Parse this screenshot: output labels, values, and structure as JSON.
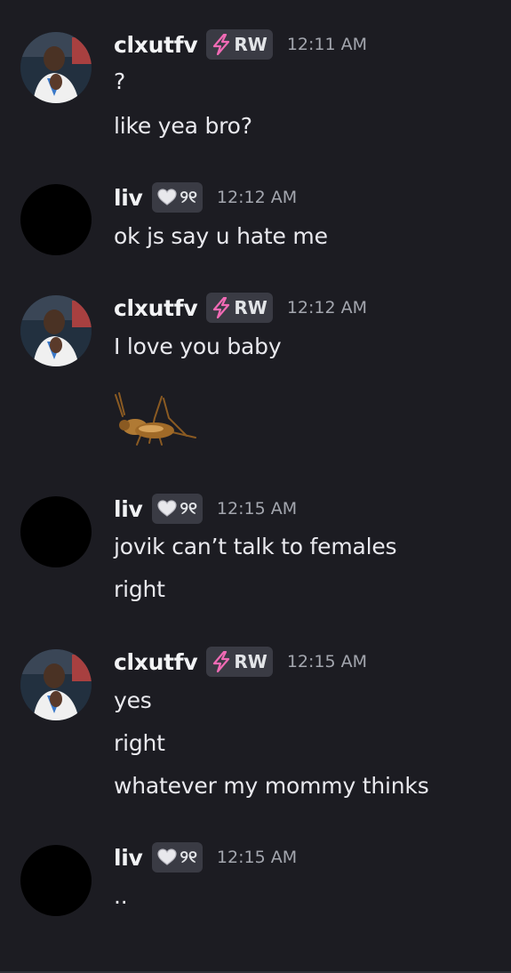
{
  "messages": [
    {
      "user": "clxutfv",
      "tag": "RW",
      "tag_icon": "lightning-bolt-icon",
      "time": "12:11 AM",
      "lines": [
        "?",
        "like yea bro?"
      ]
    },
    {
      "user": "liv",
      "tag": "୨୧",
      "tag_icon": "heart-icon",
      "time": "12:12 AM",
      "lines": [
        "ok js say u hate me"
      ]
    },
    {
      "user": "clxutfv",
      "tag": "RW",
      "tag_icon": "lightning-bolt-icon",
      "time": "12:12 AM",
      "lines": [
        "I love you baby"
      ],
      "sticker": "cricket-sticker"
    },
    {
      "user": "liv",
      "tag": "୨୧",
      "tag_icon": "heart-icon",
      "time": "12:15 AM",
      "lines": [
        "jovik can’t talk to females",
        "right"
      ]
    },
    {
      "user": "clxutfv",
      "tag": "RW",
      "tag_icon": "lightning-bolt-icon",
      "time": "12:15 AM",
      "lines": [
        "yes",
        "right",
        "whatever my mommy thinks"
      ]
    },
    {
      "user": "liv",
      "tag": "୨୧",
      "tag_icon": "heart-icon",
      "time": "12:15 AM",
      "lines": [
        ".."
      ]
    }
  ],
  "colors": {
    "background": "#1c1c22",
    "username": "#f2f3f5",
    "timestamp": "#a3a6ae",
    "tag_background": "#3a3b44",
    "bolt": "#f06ab4"
  }
}
